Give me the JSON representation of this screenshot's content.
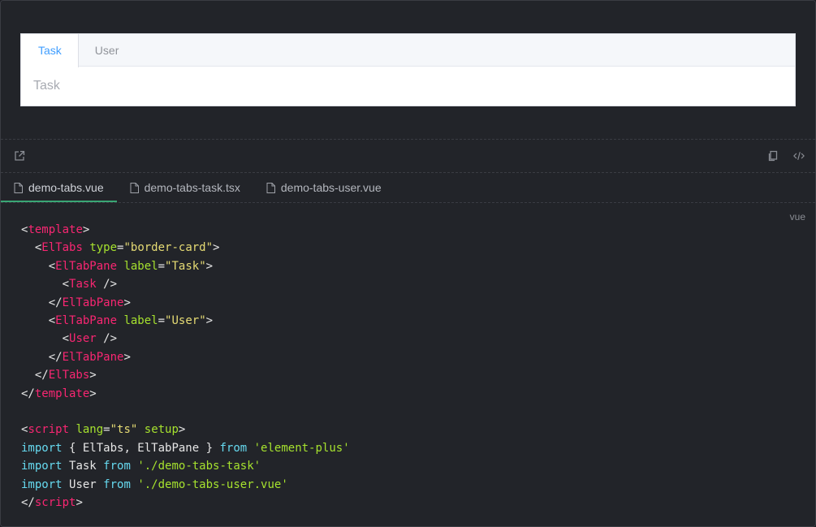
{
  "preview": {
    "tabs": [
      {
        "label": "Task",
        "active": true
      },
      {
        "label": "User",
        "active": false
      }
    ],
    "pane_content": "Task"
  },
  "toolbar": {
    "left_icon": "external-link-icon",
    "right_icons": [
      "copy-icon",
      "code-icon"
    ]
  },
  "files": [
    {
      "name": "demo-tabs.vue",
      "active": true
    },
    {
      "name": "demo-tabs-task.tsx",
      "active": false
    },
    {
      "name": "demo-tabs-user.vue",
      "active": false
    }
  ],
  "code": {
    "language": "vue",
    "tokens": {
      "template": "template",
      "ElTabs": "ElTabs",
      "type": "type",
      "border_card": "\"border-card\"",
      "ElTabPane": "ElTabPane",
      "label": "label",
      "task_str": "\"Task\"",
      "user_str": "\"User\"",
      "Task": "Task",
      "User": "User",
      "script": "script",
      "lang": "lang",
      "ts_str": "\"ts\"",
      "setup": "setup",
      "import": "import",
      "from": "from",
      "el_imports": "{ ElTabs, ElTabPane }",
      "element_plus": "'element-plus'",
      "task_path": "'./demo-tabs-task'",
      "user_path": "'./demo-tabs-user.vue'"
    }
  },
  "colors": {
    "tab_active": "#409eff",
    "file_tab_underline": "#3aa675",
    "code_tag": "#f92672",
    "code_attr": "#a6e22e",
    "code_string": "#e6db74",
    "code_keyword": "#66d9ef"
  }
}
